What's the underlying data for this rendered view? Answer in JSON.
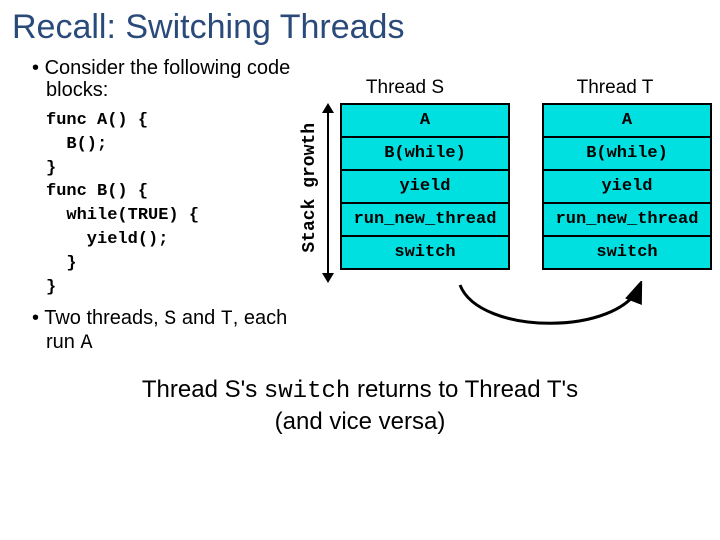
{
  "title": "Recall: Switching Threads",
  "bullet1_prefix": "Consider the following code blocks:",
  "code_block": "func A() {\n  B();\n}\nfunc B() {\n  while(TRUE) {\n    yield();\n  }\n}",
  "bullet2_html_parts": {
    "pre": "Two threads, ",
    "s": "S",
    "mid": " and ",
    "t": "T",
    "post": ", each run ",
    "a": "A"
  },
  "thread_s_label": "Thread S",
  "thread_t_label": "Thread T",
  "stack_growth_label": "Stack growth",
  "stack_cells": [
    "A",
    "B(while)",
    "yield",
    "run_new_thread",
    "switch"
  ],
  "bottom_line1_pre": "Thread S's ",
  "bottom_line1_mono": "switch",
  "bottom_line1_post": " returns to Thread T's",
  "bottom_line2": "(and vice versa)",
  "colors": {
    "title": "#2a4a7a",
    "cell_bg": "#00e0e0"
  }
}
